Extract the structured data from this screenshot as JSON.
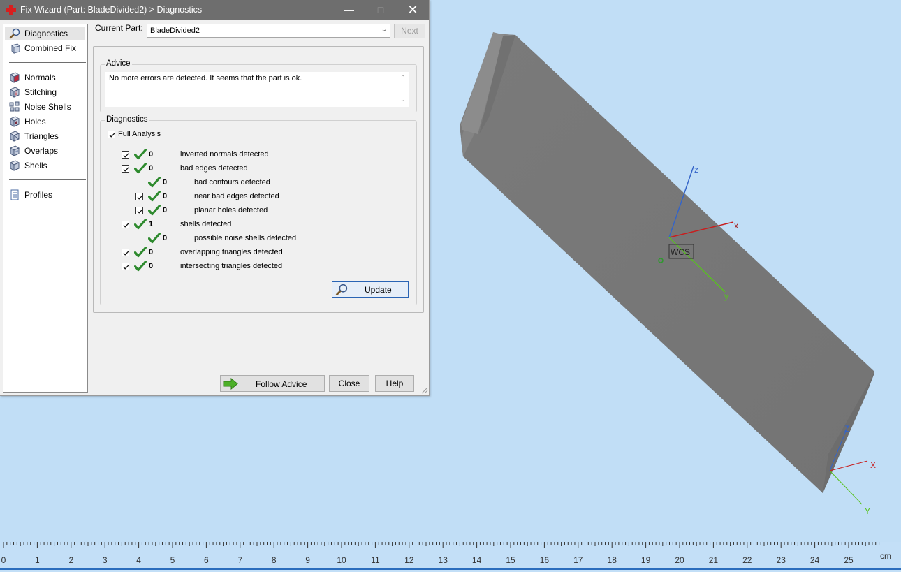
{
  "window": {
    "title": "Fix Wizard (Part: BladeDivided2) > Diagnostics",
    "minimize_icon": "minimize-icon",
    "maximize_icon": "maximize-icon",
    "close_icon": "close-icon"
  },
  "nav": {
    "top": [
      {
        "label": "Diagnostics",
        "icon": "magnifier-icon",
        "selected": true
      },
      {
        "label": "Combined Fix",
        "icon": "cubes-icon"
      }
    ],
    "fixes": [
      {
        "label": "Normals",
        "icon": "normals-cube-icon"
      },
      {
        "label": "Stitching",
        "icon": "stitching-cube-icon"
      },
      {
        "label": "Noise Shells",
        "icon": "noise-shells-icon"
      },
      {
        "label": "Holes",
        "icon": "holes-cube-icon"
      },
      {
        "label": "Triangles",
        "icon": "triangles-cube-icon"
      },
      {
        "label": "Overlaps",
        "icon": "overlaps-cube-icon"
      },
      {
        "label": "Shells",
        "icon": "shells-cube-icon"
      }
    ],
    "bottom": [
      {
        "label": "Profiles",
        "icon": "document-icon"
      }
    ]
  },
  "current_part": {
    "label": "Current Part:",
    "value": "BladeDivided2",
    "next_label": "Next"
  },
  "advice": {
    "title": "Advice",
    "text": "No more errors are detected. It seems that the part is ok."
  },
  "diagnostics": {
    "title": "Diagnostics",
    "full_analysis_label": "Full Analysis",
    "full_analysis_checked": true,
    "rows": [
      {
        "count": "0",
        "label": "inverted normals detected",
        "checkbox": true,
        "indent": 0
      },
      {
        "count": "0",
        "label": "bad edges detected",
        "checkbox": true,
        "indent": 0
      },
      {
        "count": "0",
        "label": "bad contours detected",
        "checkbox": false,
        "indent": 1
      },
      {
        "count": "0",
        "label": "near bad edges detected",
        "checkbox": true,
        "indent": 1
      },
      {
        "count": "0",
        "label": "planar holes detected",
        "checkbox": true,
        "indent": 1
      },
      {
        "count": "1",
        "label": "shells detected",
        "checkbox": true,
        "indent": 0
      },
      {
        "count": "0",
        "label": "possible noise shells detected",
        "checkbox": false,
        "indent": 1
      },
      {
        "count": "0",
        "label": "overlapping triangles detected",
        "checkbox": true,
        "indent": 0
      },
      {
        "count": "0",
        "label": "intersecting triangles detected",
        "checkbox": true,
        "indent": 0
      }
    ],
    "update_label": "Update"
  },
  "footer": {
    "follow_advice_label": "Follow Advice",
    "close_label": "Close",
    "help_label": "Help"
  },
  "viewport": {
    "wcs_label": "WCS",
    "axis_x": "x",
    "axis_y": "y",
    "axis_z": "z",
    "corner_axis_x": "X",
    "corner_axis_y": "Y",
    "corner_axis_z": "Z",
    "model_color": "#7c7c7c",
    "background_color": "#c1def6"
  },
  "ruler": {
    "ticks": [
      "0",
      "1",
      "2",
      "3",
      "4",
      "5",
      "6",
      "7",
      "8",
      "9",
      "10",
      "11",
      "12",
      "13",
      "14",
      "15",
      "16",
      "17",
      "18",
      "19",
      "20",
      "21",
      "22",
      "23",
      "24",
      "25"
    ],
    "unit": "cm"
  }
}
